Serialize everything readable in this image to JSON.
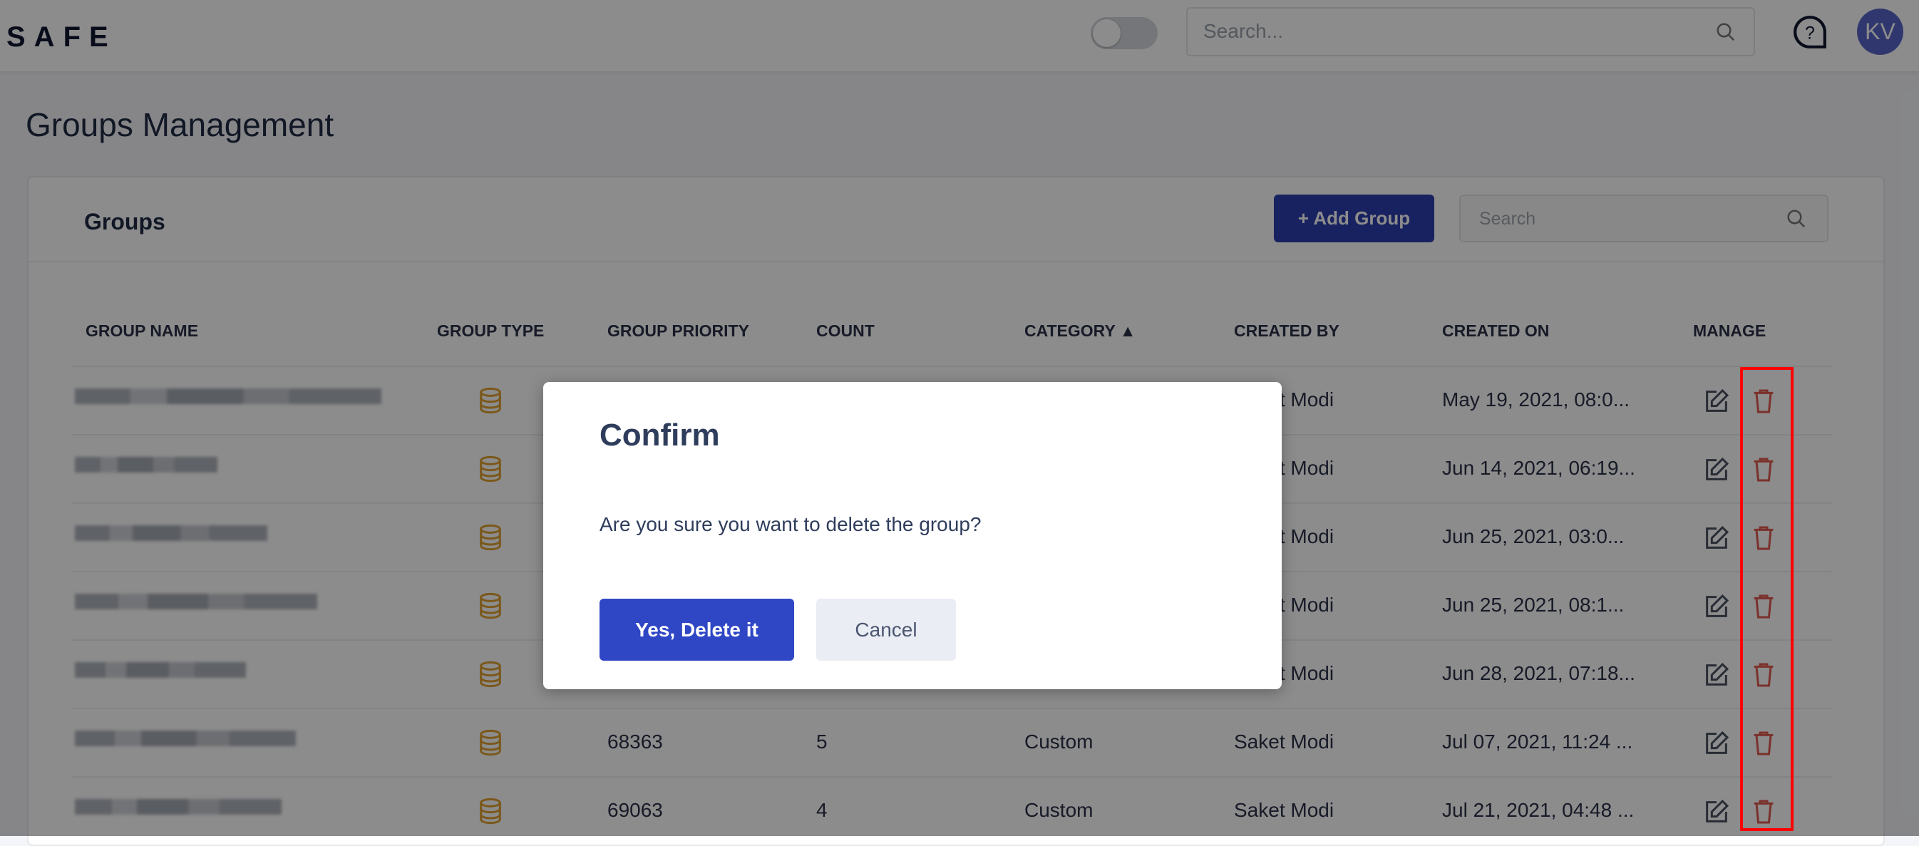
{
  "header": {
    "logo": "SAFE",
    "search_placeholder": "Search...",
    "avatar_initials": "KV",
    "toggle_on": false
  },
  "page": {
    "title": "Groups Management"
  },
  "card": {
    "title": "Groups",
    "add_button": "+ Add Group",
    "search_placeholder": "Search"
  },
  "table": {
    "columns": [
      "GROUP NAME",
      "GROUP TYPE",
      "GROUP PRIORITY",
      "COUNT",
      "CATEGORY ▲",
      "CREATED BY",
      "CREATED ON",
      "MANAGE"
    ],
    "rows": [
      {
        "priority": "",
        "count": "",
        "category": "",
        "created_by": "Saket Modi",
        "created_on": "May 19, 2021, 08:0..."
      },
      {
        "priority": "",
        "count": "",
        "category": "",
        "created_by": "Saket Modi",
        "created_on": "Jun 14, 2021, 06:19..."
      },
      {
        "priority": "",
        "count": "",
        "category": "",
        "created_by": "Saket Modi",
        "created_on": "Jun 25, 2021, 03:0..."
      },
      {
        "priority": "",
        "count": "",
        "category": "",
        "created_by": "Saket Modi",
        "created_on": "Jun 25, 2021, 08:1..."
      },
      {
        "priority": "",
        "count": "",
        "category": "",
        "created_by": "Saket Modi",
        "created_on": "Jun 28, 2021, 07:18..."
      },
      {
        "priority": "68363",
        "count": "5",
        "category": "Custom",
        "created_by": "Saket Modi",
        "created_on": "Jul 07, 2021, 11:24 ..."
      },
      {
        "priority": "69063",
        "count": "4",
        "category": "Custom",
        "created_by": "Saket Modi",
        "created_on": "Jul 21, 2021, 04:48 ..."
      }
    ]
  },
  "modal": {
    "title": "Confirm",
    "message": "Are you sure you want to delete the group?",
    "confirm_label": "Yes, Delete it",
    "cancel_label": "Cancel"
  },
  "colors": {
    "primary": "#2f47c5",
    "group_type_icon": "#e0a030",
    "delete_icon": "#e05a4f",
    "highlight": "#ff0000"
  },
  "icons": {
    "group_type": "database-icon",
    "edit": "edit-icon",
    "delete": "trash-icon",
    "search": "search-icon",
    "help": "help-chat-icon"
  }
}
